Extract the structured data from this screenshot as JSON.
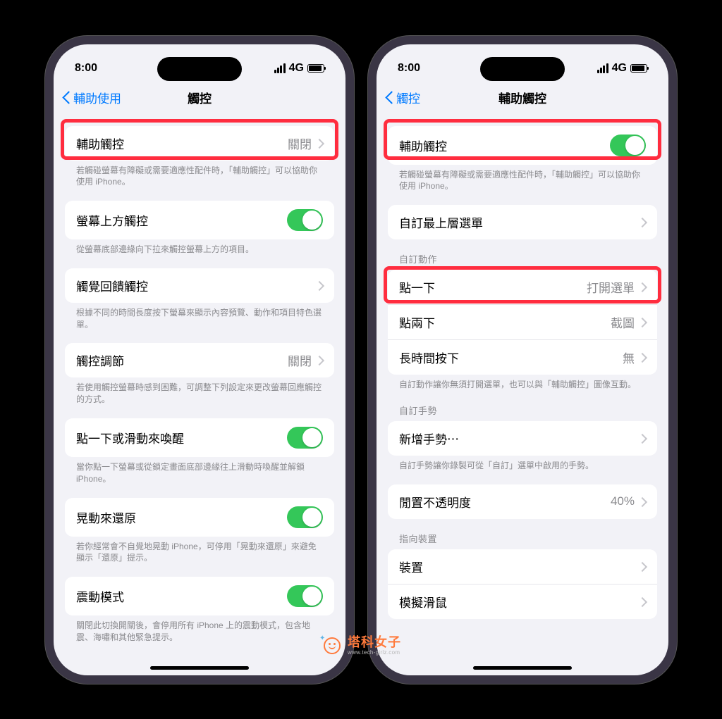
{
  "status": {
    "time": "8:00",
    "network": "4G"
  },
  "left": {
    "back": "輔助使用",
    "title": "觸控",
    "sec1": {
      "label": "輔助觸控",
      "value": "關閉",
      "footer": "若觸碰螢幕有障礙或需要適應性配件時，「輔助觸控」可以協助你使用 iPhone。"
    },
    "sec2": {
      "label": "螢幕上方觸控",
      "footer": "從螢幕底部邊緣向下拉來觸控螢幕上方的項目。"
    },
    "sec3": {
      "label": "觸覺回饋觸控",
      "footer": "根據不同的時間長度按下螢幕來顯示內容預覽、動作和項目特色選單。"
    },
    "sec4": {
      "label": "觸控調節",
      "value": "關閉",
      "footer": "若使用觸控螢幕時感到困難，可調整下列設定來更改螢幕回應觸控的方式。"
    },
    "sec5": {
      "label": "點一下或滑動來喚醒",
      "footer": "當你點一下螢幕或從鎖定畫面底部邊緣往上滑動時喚醒並解鎖 iPhone。"
    },
    "sec6": {
      "label": "晃動來還原",
      "footer": "若你經常會不自覺地晃動 iPhone，可停用「晃動來還原」來避免顯示「還原」提示。"
    },
    "sec7": {
      "label": "震動模式",
      "footer": "關閉此切換開關後，會停用所有 iPhone 上的震動模式，包含地震、海嘯和其他緊急提示。"
    }
  },
  "right": {
    "back": "觸控",
    "title": "輔助觸控",
    "sec1": {
      "label": "輔助觸控",
      "footer": "若觸碰螢幕有障礙或需要適應性配件時，「輔助觸控」可以協助你使用 iPhone。"
    },
    "sec2": {
      "label": "自訂最上層選單"
    },
    "actionsHeader": "自訂動作",
    "a1": {
      "label": "點一下",
      "value": "打開選單"
    },
    "a2": {
      "label": "點兩下",
      "value": "截圖"
    },
    "a3": {
      "label": "長時間按下",
      "value": "無"
    },
    "actionsFooter": "自訂動作讓你無須打開選單，也可以與「輔助觸控」圖像互動。",
    "gestHeader": "自訂手勢",
    "g1": {
      "label": "新增手勢⋯"
    },
    "gestFooter": "自訂手勢讓你錄製可從「自訂」選單中啟用的手勢。",
    "opacity": {
      "label": "閒置不透明度",
      "value": "40%"
    },
    "devHeader": "指向裝置",
    "d1": {
      "label": "裝置"
    },
    "d2": {
      "label": "模擬滑鼠"
    }
  },
  "watermark": {
    "text": "塔科女子",
    "url": "www.tech-girlz.com"
  }
}
